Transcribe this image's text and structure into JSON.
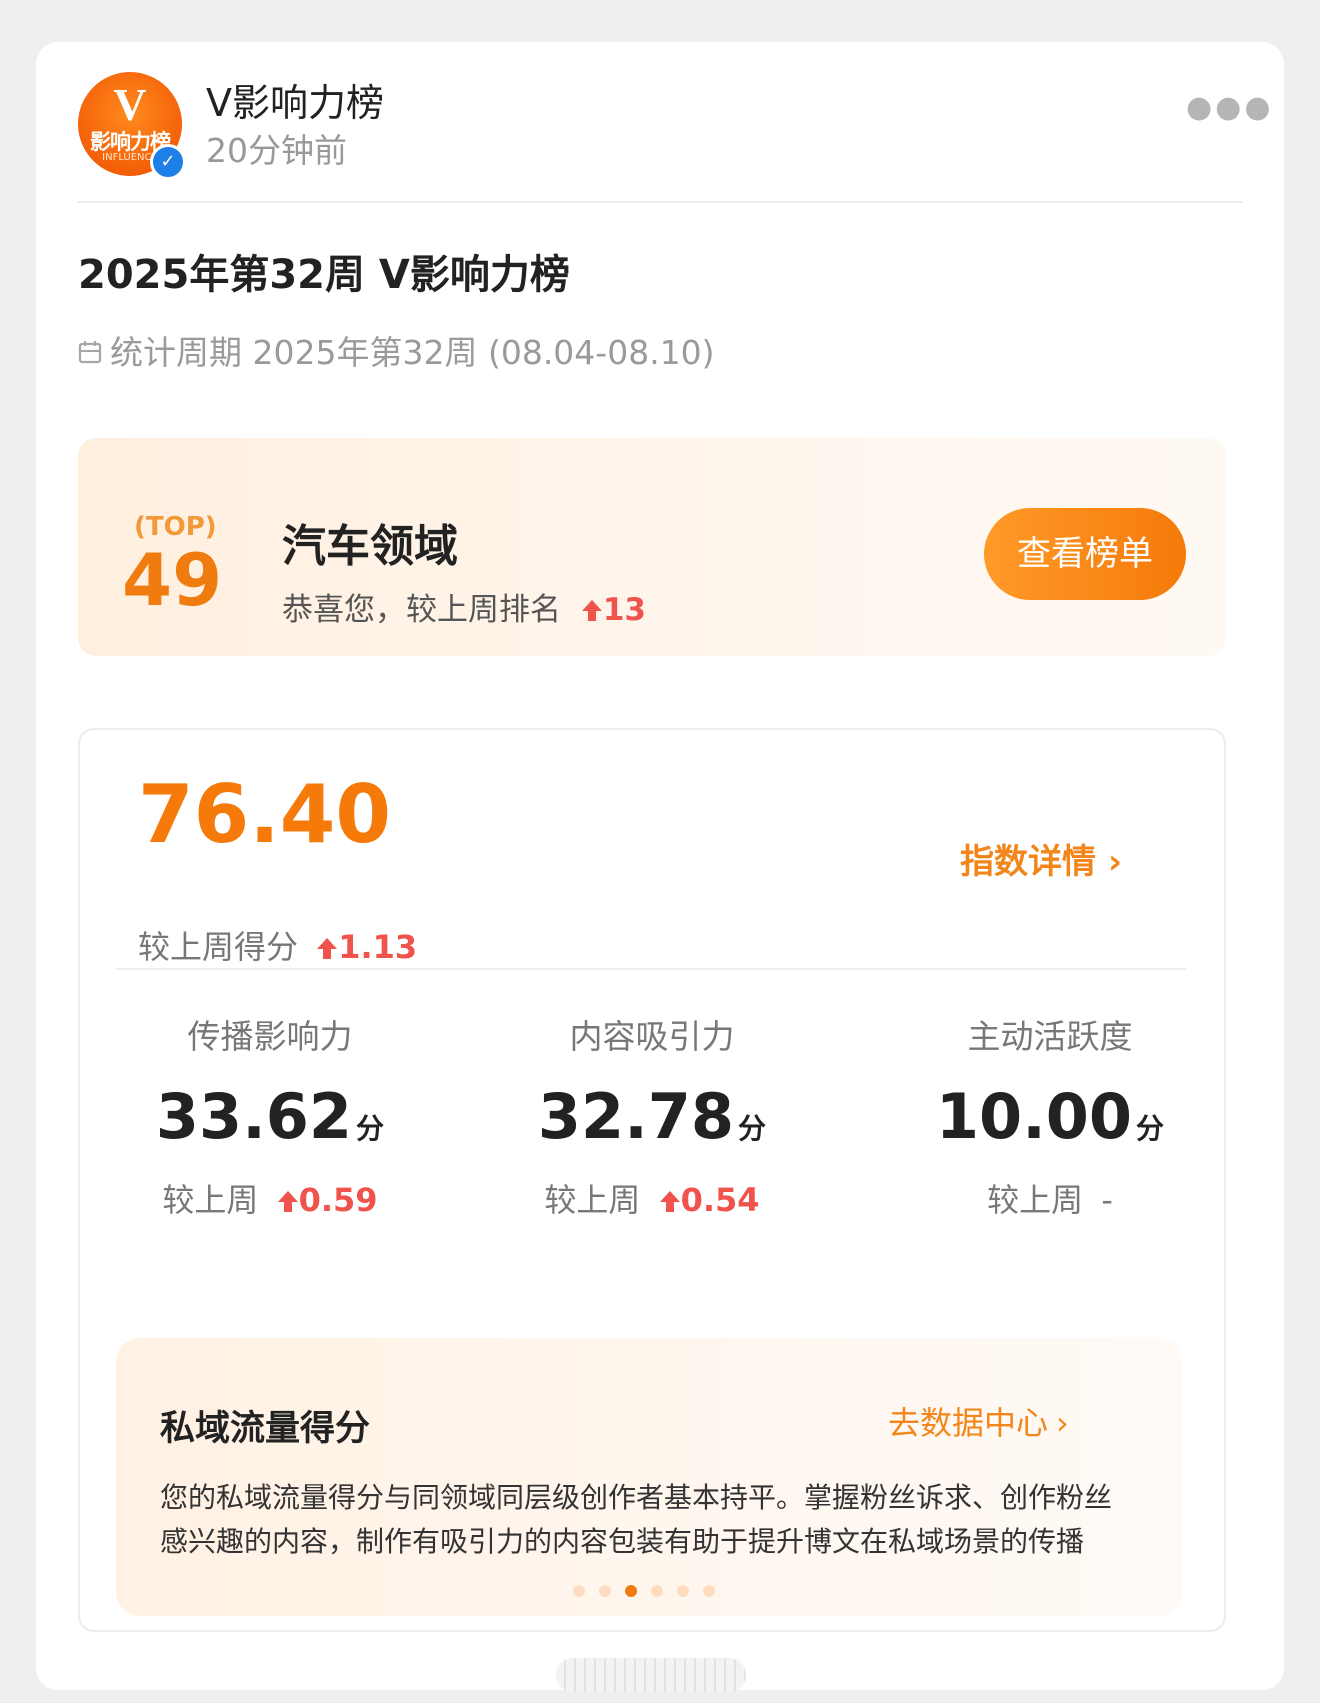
{
  "post": {
    "author": "V影响力榜",
    "time": "20分钟前",
    "more_icon": "more-dots-icon",
    "avatar": {
      "logo_letter": "V",
      "logo_text": "影响力榜",
      "logo_sub": "INFLUENCE"
    },
    "title": "2025年第32周 V影响力榜",
    "period": "统计周期 2025年第32周 (08.04-08.10)"
  },
  "rank": {
    "top_label": "TOP",
    "number": "49",
    "domain": "汽车领域",
    "change_prefix": "恭喜您，较上周排名",
    "change_value": "13",
    "button": "查看榜单"
  },
  "score": {
    "total": "76.40",
    "change_label": "较上周得分",
    "change_value": "1.13",
    "detail_link": "指数详情",
    "metrics": [
      {
        "label": "传播影响力",
        "value": "33.62",
        "unit": "分",
        "change_label": "较上周",
        "change_value": "0.59"
      },
      {
        "label": "内容吸引力",
        "value": "32.78",
        "unit": "分",
        "change_label": "较上周",
        "change_value": "0.54"
      },
      {
        "label": "主动活跃度",
        "value": "10.00",
        "unit": "分",
        "change_label": "较上周",
        "change_value": "-"
      }
    ]
  },
  "private": {
    "title": "私域流量得分",
    "link": "去数据中心",
    "description": "您的私域流量得分与同领域同层级创作者基本持平。掌握粉丝诉求、创作粉丝感兴趣的内容，制作有吸引力的内容包装有助于提升博文在私域场景的传播",
    "carousel_current": 3,
    "carousel_total": 6
  },
  "colors": {
    "accent": "#f57a0a",
    "up_red": "#f0524c",
    "verified_blue": "#1e7fe6"
  }
}
